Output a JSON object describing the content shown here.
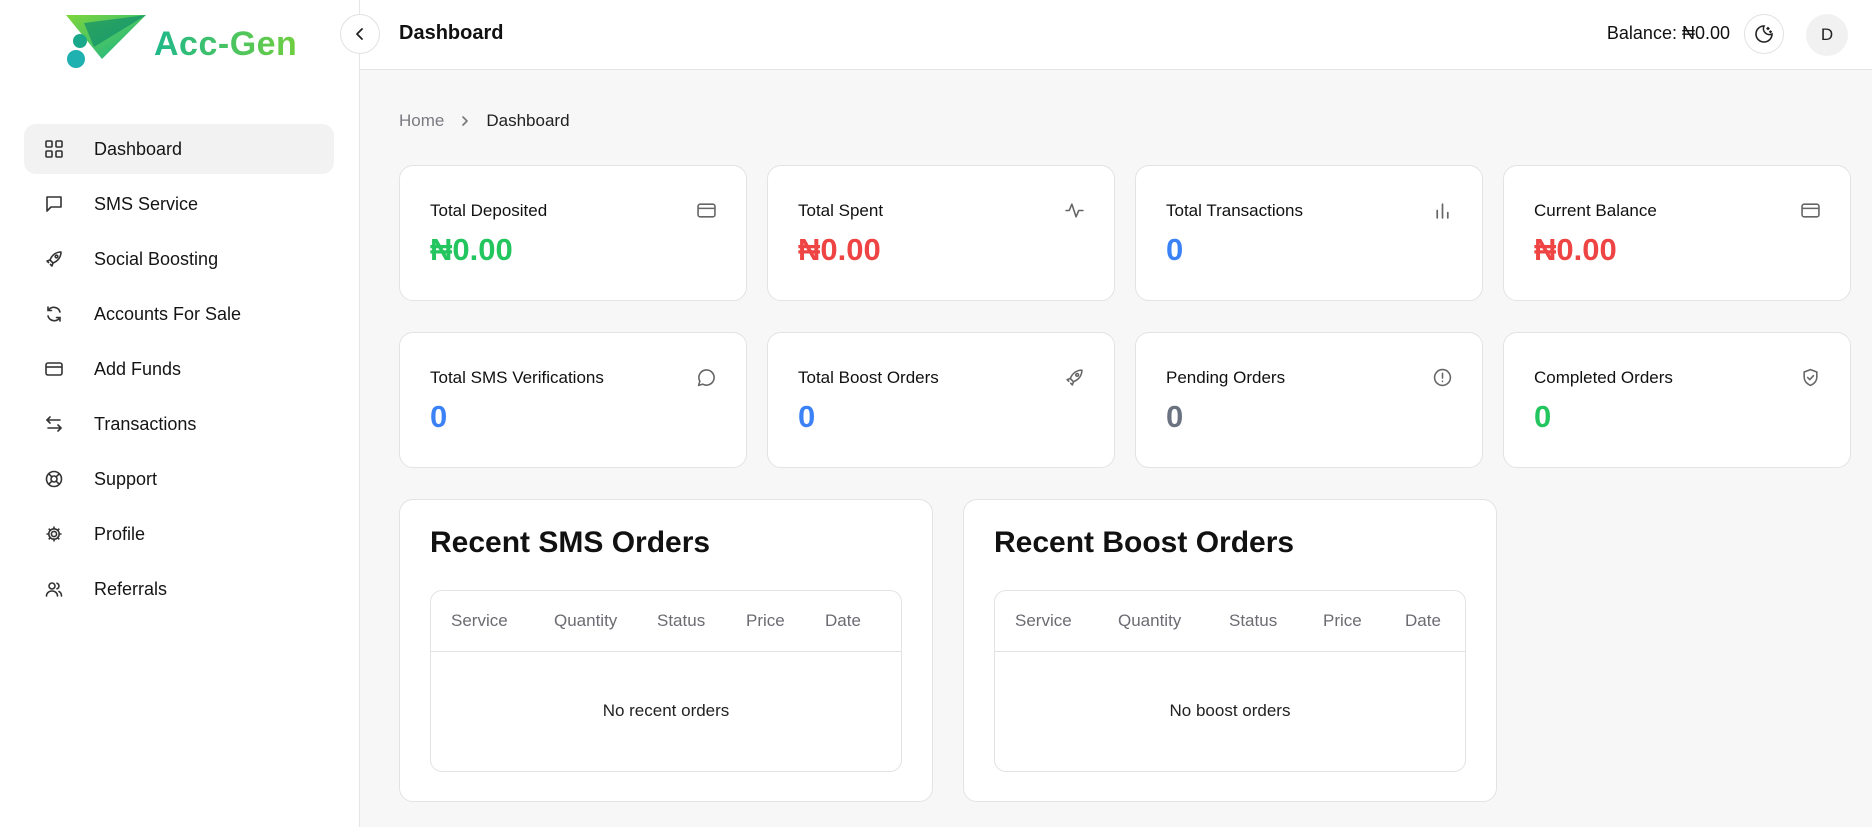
{
  "brand": {
    "name": "Acc-Gen"
  },
  "sidebar": {
    "items": [
      {
        "label": "Dashboard",
        "icon": "grid-icon",
        "active": true
      },
      {
        "label": "SMS Service",
        "icon": "message-icon"
      },
      {
        "label": "Social Boosting",
        "icon": "rocket-icon"
      },
      {
        "label": "Accounts For Sale",
        "icon": "refresh-icon"
      },
      {
        "label": "Add Funds",
        "icon": "credit-card-icon"
      },
      {
        "label": "Transactions",
        "icon": "arrows-left-right-icon"
      },
      {
        "label": "Support",
        "icon": "life-buoy-icon"
      },
      {
        "label": "Profile",
        "icon": "gear-icon"
      },
      {
        "label": "Referrals",
        "icon": "users-icon"
      }
    ]
  },
  "header": {
    "title": "Dashboard",
    "balance": "Balance: ₦0.00",
    "avatar": "D"
  },
  "breadcrumb": {
    "home": "Home",
    "current": "Dashboard"
  },
  "stats": [
    {
      "title": "Total Deposited",
      "value": "₦0.00",
      "color": "#22c55e",
      "icon": "credit-card-icon"
    },
    {
      "title": "Total Spent",
      "value": "₦0.00",
      "color": "#ef4444",
      "icon": "activity-icon"
    },
    {
      "title": "Total Transactions",
      "value": "0",
      "color": "#3b82f6",
      "icon": "bar-chart-icon"
    },
    {
      "title": "Current Balance",
      "value": "₦0.00",
      "color": "#ef4444",
      "icon": "credit-card-icon"
    },
    {
      "title": "Total SMS Verifications",
      "value": "0",
      "color": "#3b82f6",
      "icon": "message-icon"
    },
    {
      "title": "Total Boost Orders",
      "value": "0",
      "color": "#3b82f6",
      "icon": "rocket-icon"
    },
    {
      "title": "Pending Orders",
      "value": "0",
      "color": "#6b7280",
      "icon": "alert-circle-icon"
    },
    {
      "title": "Completed Orders",
      "value": "0",
      "color": "#22c55e",
      "icon": "shield-check-icon"
    }
  ],
  "sms_orders": {
    "title": "Recent SMS Orders",
    "columns": [
      "Service",
      "Quantity",
      "Status",
      "Price",
      "Date"
    ],
    "empty": "No recent orders"
  },
  "boost_orders": {
    "title": "Recent Boost Orders",
    "columns": [
      "Service",
      "Quantity",
      "Status",
      "Price",
      "Date"
    ],
    "empty": "No boost orders"
  }
}
